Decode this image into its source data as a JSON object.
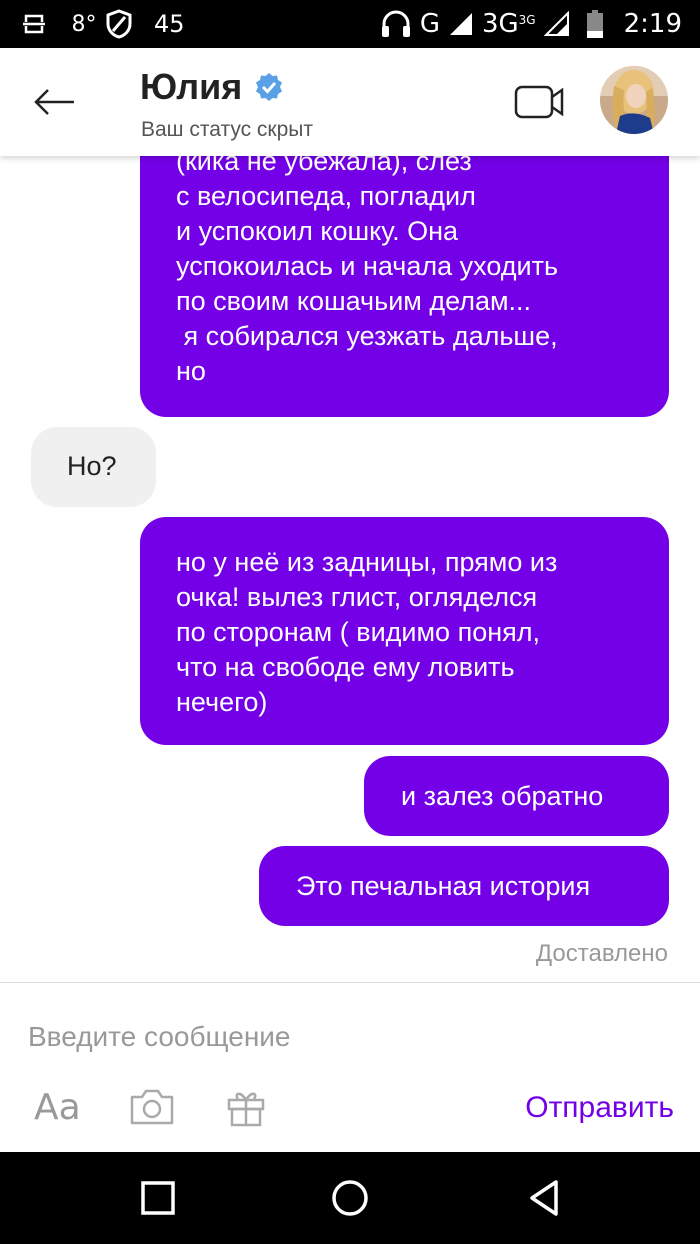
{
  "statusbar": {
    "temp": "8°",
    "count": "45",
    "network1": "G",
    "network2": "3G",
    "network2_sup": "3G",
    "time": "2:19"
  },
  "header": {
    "contact_name": "Юлия",
    "status": "Ваш статус скрыт",
    "icons": [
      "back-arrow-icon",
      "verified-badge-icon",
      "video-camera-icon",
      "avatar"
    ]
  },
  "messages": [
    {
      "direction": "outgoing",
      "lines": [
        "(кика не убежала), слез",
        "с велосипеда, погладил",
        "и успокоил кошку. Она",
        "успокоилась и начала уходить",
        "по своим кошачьим делам...",
        " я собирался уезжать дальше,",
        "но"
      ]
    },
    {
      "direction": "incoming",
      "text": "Но?"
    },
    {
      "direction": "outgoing",
      "lines": [
        "но у неё из задницы, прямо из",
        "очка! вылез глист, огляделся",
        "по сторонам ( видимо понял,",
        "что на свободе ему ловить",
        "нечего)"
      ]
    },
    {
      "direction": "outgoing",
      "text": "и залез обратно"
    },
    {
      "direction": "outgoing",
      "text": "Это печальная история"
    }
  ],
  "delivered": "Доставлено",
  "composer": {
    "placeholder": "Введите сообщение",
    "format_label": "Aa",
    "send_label": "Отправить"
  },
  "colors": {
    "accent": "#7300e6",
    "incoming_bubble": "#f0f0f0",
    "statusbar": "#000000"
  }
}
